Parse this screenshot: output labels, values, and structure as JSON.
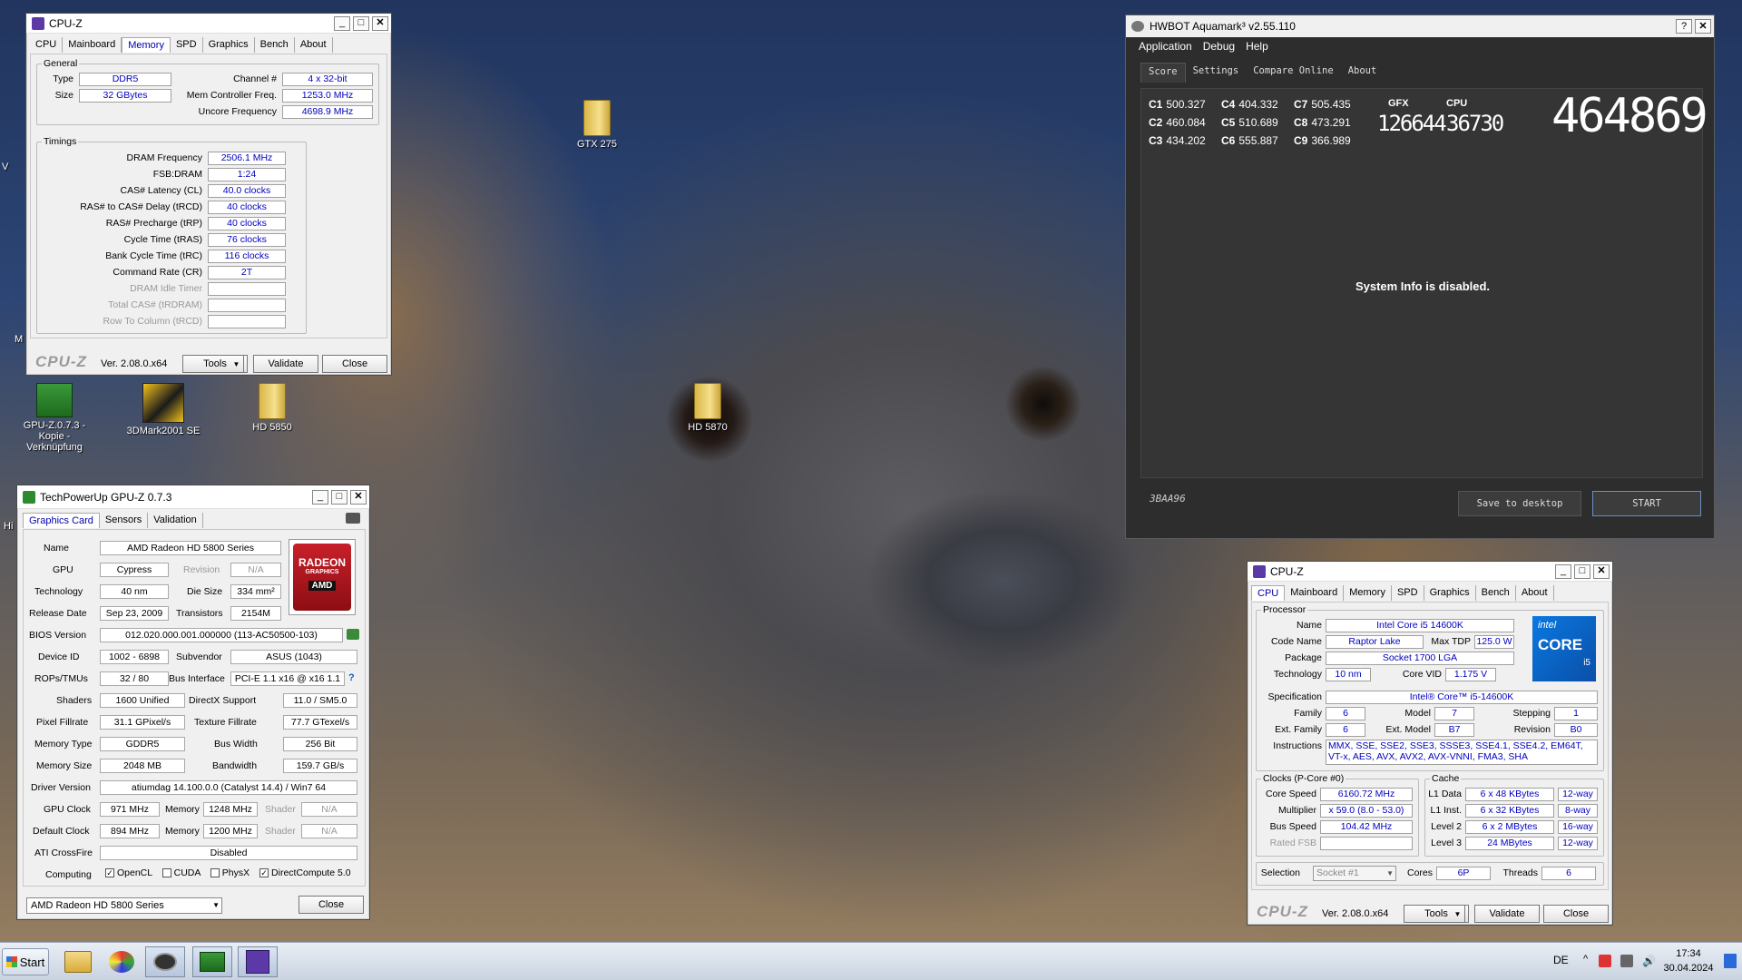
{
  "desktop": {
    "icons": [
      {
        "label": "GTX 275",
        "kind": "folder"
      },
      {
        "label": "GPU-Z.0.7.3 - Kopie - Verknüpfung",
        "kind": "gpuz"
      },
      {
        "label": "3DMark2001 SE",
        "kind": "3dmark"
      },
      {
        "label": "HD 5850",
        "kind": "folder"
      },
      {
        "label": "HD 5870",
        "kind": "folder"
      }
    ],
    "edge_letters": [
      "V",
      "M",
      "Hi"
    ]
  },
  "cpuz_memory": {
    "title": "CPU-Z",
    "tabs": [
      "CPU",
      "Mainboard",
      "Memory",
      "SPD",
      "Graphics",
      "Bench",
      "About"
    ],
    "active_tab": "Memory",
    "general_label": "General",
    "type_label": "Type",
    "type": "DDR5",
    "size_label": "Size",
    "size": "32 GBytes",
    "channel_label": "Channel #",
    "channel": "4 x 32-bit",
    "mcf_label": "Mem Controller Freq.",
    "mcf": "1253.0 MHz",
    "uncore_label": "Uncore Frequency",
    "uncore": "4698.9 MHz",
    "timings_label": "Timings",
    "timings": [
      {
        "label": "DRAM Frequency",
        "value": "2506.1 MHz",
        "enabled": true
      },
      {
        "label": "FSB:DRAM",
        "value": "1:24",
        "enabled": true
      },
      {
        "label": "CAS# Latency (CL)",
        "value": "40.0 clocks",
        "enabled": true
      },
      {
        "label": "RAS# to CAS# Delay (tRCD)",
        "value": "40 clocks",
        "enabled": true
      },
      {
        "label": "RAS# Precharge (tRP)",
        "value": "40 clocks",
        "enabled": true
      },
      {
        "label": "Cycle Time (tRAS)",
        "value": "76 clocks",
        "enabled": true
      },
      {
        "label": "Bank Cycle Time (tRC)",
        "value": "116 clocks",
        "enabled": true
      },
      {
        "label": "Command Rate (CR)",
        "value": "2T",
        "enabled": true
      },
      {
        "label": "DRAM Idle Timer",
        "value": "",
        "enabled": false
      },
      {
        "label": "Total CAS# (tRDRAM)",
        "value": "",
        "enabled": false
      },
      {
        "label": "Row To Column (tRCD)",
        "value": "",
        "enabled": false
      }
    ],
    "logo": "CPU-Z",
    "version": "Ver. 2.08.0.x64",
    "tools": "Tools",
    "validate": "Validate",
    "close": "Close"
  },
  "gpuz": {
    "title": "TechPowerUp GPU-Z 0.7.3",
    "tabs": [
      "Graphics Card",
      "Sensors",
      "Validation"
    ],
    "active_tab": "Graphics Card",
    "name_label": "Name",
    "name": "AMD Radeon HD 5800 Series",
    "gpu_label": "GPU",
    "gpu": "Cypress",
    "revision_label": "Revision",
    "revision": "N/A",
    "tech_label": "Technology",
    "tech": "40 nm",
    "die_label": "Die Size",
    "die": "334 mm²",
    "release_label": "Release Date",
    "release": "Sep 23, 2009",
    "trans_label": "Transistors",
    "trans": "2154M",
    "bios_label": "BIOS Version",
    "bios": "012.020.000.001.000000 (113-AC50500-103)",
    "devid_label": "Device ID",
    "devid": "1002 - 6898",
    "subv_label": "Subvendor",
    "subv": "ASUS (1043)",
    "rops_label": "ROPs/TMUs",
    "rops": "32 / 80",
    "bus_label": "Bus Interface",
    "bus": "PCI-E 1.1 x16 @ x16 1.1",
    "shaders_label": "Shaders",
    "shaders": "1600 Unified",
    "dx_label": "DirectX Support",
    "dx": "11.0 / SM5.0",
    "pix_label": "Pixel Fillrate",
    "pix": "31.1 GPixel/s",
    "tex_label": "Texture Fillrate",
    "tex": "77.7 GTexel/s",
    "memtype_label": "Memory Type",
    "memtype": "GDDR5",
    "buswidth_label": "Bus Width",
    "buswidth": "256 Bit",
    "memsize_label": "Memory Size",
    "memsize": "2048 MB",
    "bw_label": "Bandwidth",
    "bw": "159.7 GB/s",
    "driver_label": "Driver Version",
    "driver": "atiumdag 14.100.0.0 (Catalyst 14.4) / Win7 64",
    "gclk_label": "GPU Clock",
    "gclk": "971 MHz",
    "mem_label": "Memory",
    "mclk": "1248 MHz",
    "shader_label": "Shader",
    "shader": "N/A",
    "dclk_label": "Default Clock",
    "dclk": "894 MHz",
    "dmclk": "1200 MHz",
    "dshader": "N/A",
    "cf_label": "ATI CrossFire",
    "cf": "Disabled",
    "comp_label": "Computing",
    "compute": [
      {
        "label": "OpenCL",
        "checked": true
      },
      {
        "label": "CUDA",
        "checked": false
      },
      {
        "label": "PhysX",
        "checked": false
      },
      {
        "label": "DirectCompute 5.0",
        "checked": true
      }
    ],
    "logo_top": "RADEON",
    "logo_mid": "GRAPHICS",
    "logo_bot": "AMD",
    "select": "AMD Radeon HD 5800 Series",
    "close": "Close",
    "help": "?"
  },
  "aquamark": {
    "title": "HWBOT Aquamark³ v2.55.110",
    "help": "?",
    "menu": [
      "Application",
      "Debug",
      "Help"
    ],
    "tabs": [
      "Score",
      "Settings",
      "Compare Online",
      "About"
    ],
    "active_tab": "Score",
    "scores": [
      {
        "k": "C1",
        "v": "500.327"
      },
      {
        "k": "C2",
        "v": "460.084"
      },
      {
        "k": "C3",
        "v": "434.202"
      },
      {
        "k": "C4",
        "v": "404.332"
      },
      {
        "k": "C5",
        "v": "510.689"
      },
      {
        "k": "C6",
        "v": "555.887"
      },
      {
        "k": "C7",
        "v": "505.435"
      },
      {
        "k": "C8",
        "v": "473.291"
      },
      {
        "k": "C9",
        "v": "366.989"
      }
    ],
    "gfx_label": "GFX",
    "gfx": "126644",
    "cpu_label": "CPU",
    "cpu": "36730",
    "total": "464869",
    "sysinfo": "System Info is disabled.",
    "code": "3BAA96",
    "save": "Save to desktop",
    "start": "START"
  },
  "cpuz_cpu": {
    "title": "CPU-Z",
    "tabs": [
      "CPU",
      "Mainboard",
      "Memory",
      "SPD",
      "Graphics",
      "Bench",
      "About"
    ],
    "active_tab": "CPU",
    "processor_label": "Processor",
    "name_label": "Name",
    "name": "Intel Core i5 14600K",
    "code_label": "Code Name",
    "code": "Raptor Lake",
    "tdp_label": "Max TDP",
    "tdp": "125.0 W",
    "pkg_label": "Package",
    "pkg": "Socket 1700 LGA",
    "tech_label": "Technology",
    "tech": "10 nm",
    "vid_label": "Core VID",
    "vid": "1.175 V",
    "spec_label": "Specification",
    "spec": "Intel® Core™ i5-14600K",
    "family_label": "Family",
    "family": "6",
    "model_label": "Model",
    "model": "7",
    "step_label": "Stepping",
    "step": "1",
    "efam_label": "Ext. Family",
    "efam": "6",
    "emodel_label": "Ext. Model",
    "emodel": "B7",
    "rev_label": "Revision",
    "rev": "B0",
    "instr_label": "Instructions",
    "instr": "MMX, SSE, SSE2, SSE3, SSSE3, SSE4.1, SSE4.2, EM64T, VT-x, AES, AVX, AVX2, AVX-VNNI, FMA3, SHA",
    "clocks_label": "Clocks (P-Core #0)",
    "speed_label": "Core Speed",
    "speed": "6160.72 MHz",
    "mult_label": "Multiplier",
    "mult": "x 59.0 (8.0 - 53.0)",
    "bus_label": "Bus Speed",
    "bus": "104.42 MHz",
    "fsb_label": "Rated FSB",
    "fsb": "",
    "cache_label": "Cache",
    "l1d_label": "L1 Data",
    "l1d": "6 x 48 KBytes",
    "l1d_w": "12-way",
    "l1i_label": "L1 Inst.",
    "l1i": "6 x 32 KBytes",
    "l1i_w": "8-way",
    "l2_label": "Level 2",
    "l2": "6 x 2 MBytes",
    "l2_w": "16-way",
    "l3_label": "Level 3",
    "l3": "24 MBytes",
    "l3_w": "12-way",
    "sel_label": "Selection",
    "sel": "Socket #1",
    "cores_label": "Cores",
    "cores": "6P",
    "threads_label": "Threads",
    "threads": "6",
    "badge_top": "intel",
    "badge_mid": "CORE",
    "badge_bot": "i5",
    "logo": "CPU-Z",
    "version": "Ver. 2.08.0.x64",
    "tools": "Tools",
    "validate": "Validate",
    "close": "Close"
  },
  "taskbar": {
    "start": "Start",
    "lang": "DE",
    "time": "17:34",
    "date": "30.04.2024",
    "up": "^"
  },
  "colors": {
    "value_text": "#0000c0",
    "aq_bg": "#2d2d2d",
    "intel_blue": "#0a6fd0",
    "amd_red": "#b5121b"
  }
}
